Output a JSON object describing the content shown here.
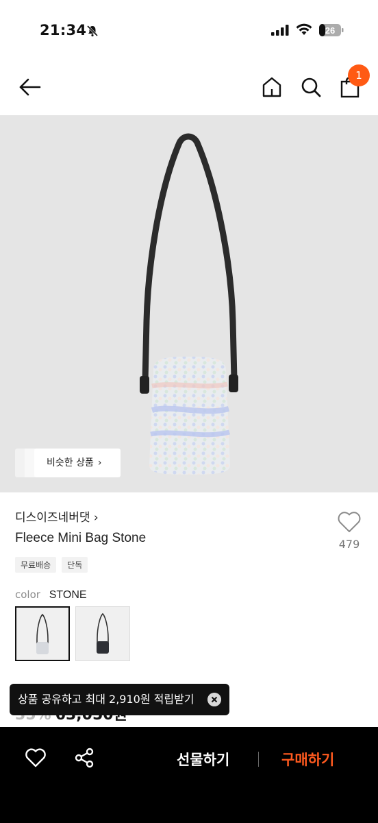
{
  "status_bar": {
    "time": "21:34",
    "battery": "26"
  },
  "nav": {
    "cart_count": "1"
  },
  "hero": {
    "similar_label": "비슷한 상품",
    "chevron": "›"
  },
  "product": {
    "brand": "디스이즈네버댓 ›",
    "name": "Fleece Mini Bag Stone",
    "like_count": "479",
    "tags": [
      "무료배송",
      "단독"
    ],
    "color_label": "color",
    "color_value": "STONE",
    "price_discount": "35%",
    "price": "63,050원"
  },
  "toast": {
    "text": "상품 공유하고 최대 2,910원 적립받기"
  },
  "bottom_bar": {
    "gift_label": "선물하기",
    "buy_label": "구매하기"
  },
  "colors": {
    "accent": "#ff5a14",
    "buy": "#ff5a1f",
    "hero_bg": "#e5e5e5"
  },
  "icons": [
    "bell-off-icon",
    "signal-icon",
    "wifi-icon",
    "battery-icon",
    "back-arrow-icon",
    "home-icon",
    "search-icon",
    "shopping-bag-icon",
    "heart-icon",
    "share-icon",
    "close-icon"
  ]
}
